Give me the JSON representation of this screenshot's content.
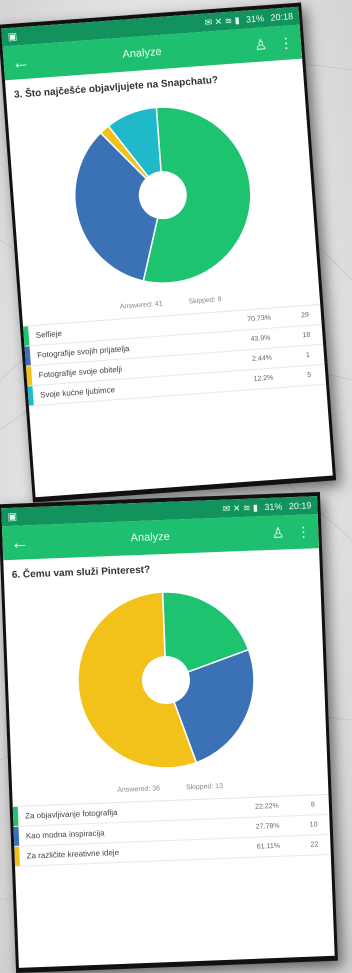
{
  "screens": [
    {
      "status_time": "20:18",
      "status_battery": "31%",
      "title": "Analyze",
      "question": "3. Što najčešće objavljujete na Snapchatu?",
      "answered": "Answered: 41",
      "skipped": "Skipped: 8",
      "rows": [
        {
          "label": "Selfieje",
          "pct": "70.73%",
          "count": "29",
          "color": "#1ec36f"
        },
        {
          "label": "Fotografije svojih prijatelja",
          "pct": "43.9%",
          "count": "18",
          "color": "#3a72b5"
        },
        {
          "label": "Fotografije svoje obitelji",
          "pct": "2.44%",
          "count": "1",
          "color": "#f3c21a"
        },
        {
          "label": "Svoje kućne ljubimce",
          "pct": "12.2%",
          "count": "5",
          "color": "#20b9c9"
        }
      ],
      "chart_data": {
        "type": "pie",
        "labels": [
          "Selfieje",
          "Fotografije svojih prijatelja",
          "Fotografije svoje obitelji",
          "Svoje kućne ljubimce"
        ],
        "values": [
          70.73,
          43.9,
          2.44,
          12.2
        ],
        "colors": [
          "#1ec36f",
          "#3a72b5",
          "#f3c21a",
          "#20b9c9"
        ]
      }
    },
    {
      "status_time": "20:19",
      "status_battery": "31%",
      "title": "Analyze",
      "question": "6. Čemu vam služi Pinterest?",
      "answered": "Answered: 36",
      "skipped": "Skipped: 13",
      "rows": [
        {
          "label": "Za objavljivanje fotografija",
          "pct": "22.22%",
          "count": "8",
          "color": "#1ec36f"
        },
        {
          "label": "Kao modna inspiracija",
          "pct": "27.78%",
          "count": "10",
          "color": "#3a72b5"
        },
        {
          "label": "Za različite kreativne ideje",
          "pct": "61.11%",
          "count": "22",
          "color": "#f3c21a"
        }
      ],
      "chart_data": {
        "type": "pie",
        "labels": [
          "Za objavljivanje fotografija",
          "Kao modna inspiracija",
          "Za različite kreativne ideje"
        ],
        "values": [
          22.22,
          27.78,
          61.11
        ],
        "colors": [
          "#1ec36f",
          "#3a72b5",
          "#f3c21a"
        ]
      }
    }
  ],
  "icons": {
    "back": "arrow-left-icon",
    "user": "user-share-icon",
    "menu": "more-vert-icon"
  }
}
